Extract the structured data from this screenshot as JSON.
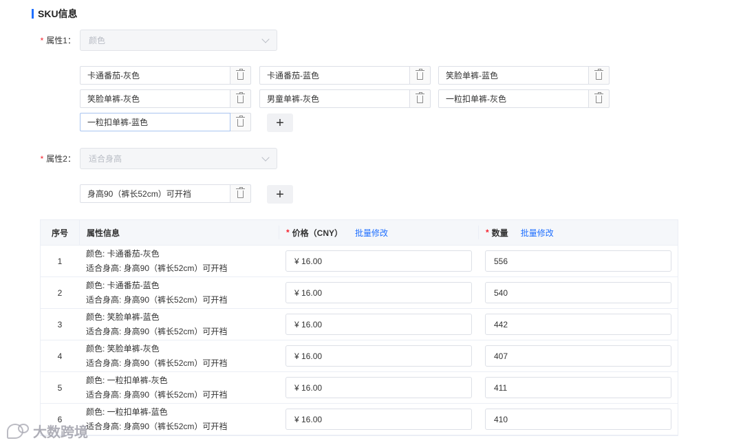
{
  "section_title": "SKU信息",
  "attributes": [
    {
      "label": "属性1",
      "required_mark": "*",
      "colon": "：",
      "placeholder": "颜色",
      "values": [
        "卡通番茄-灰色",
        "卡通番茄-蓝色",
        "笑脸单裤-蓝色",
        "笑脸单裤-灰色",
        "男童单裤-灰色",
        "一粒扣单裤-灰色",
        "一粒扣单裤-蓝色"
      ]
    },
    {
      "label": "属性2",
      "required_mark": "*",
      "colon": "：",
      "placeholder": "适合身高",
      "values": [
        "身高90（裤长52cm）可开裆"
      ]
    }
  ],
  "add_symbol": "+",
  "table": {
    "headers": {
      "index": "序号",
      "attr": "属性信息",
      "price": "价格（CNY）",
      "qty": "数量",
      "batch_edit": "批量修改",
      "required_mark": "*"
    },
    "rows": [
      {
        "index": "1",
        "line1": "颜色: 卡通番茄-灰色",
        "line2": "适合身高: 身高90（裤长52cm）可开裆",
        "price": "¥ 16.00",
        "qty": "556"
      },
      {
        "index": "2",
        "line1": "颜色: 卡通番茄-蓝色",
        "line2": "适合身高: 身高90（裤长52cm）可开裆",
        "price": "¥ 16.00",
        "qty": "540"
      },
      {
        "index": "3",
        "line1": "颜色: 笑脸单裤-蓝色",
        "line2": "适合身高: 身高90（裤长52cm）可开裆",
        "price": "¥ 16.00",
        "qty": "442"
      },
      {
        "index": "4",
        "line1": "颜色: 笑脸单裤-灰色",
        "line2": "适合身高: 身高90（裤长52cm）可开裆",
        "price": "¥ 16.00",
        "qty": "407"
      },
      {
        "index": "5",
        "line1": "颜色: 一粒扣单裤-灰色",
        "line2": "适合身高: 身高90（裤长52cm）可开裆",
        "price": "¥ 16.00",
        "qty": "411"
      },
      {
        "index": "6",
        "line1": "颜色: 一粒扣单裤-蓝色",
        "line2": "适合身高: 身高90（裤长52cm）可开裆",
        "price": "¥ 16.00",
        "qty": "410"
      }
    ]
  },
  "watermark": "大数跨境",
  "colors": {
    "accent": "#1f6fff",
    "required": "#f5222d"
  }
}
